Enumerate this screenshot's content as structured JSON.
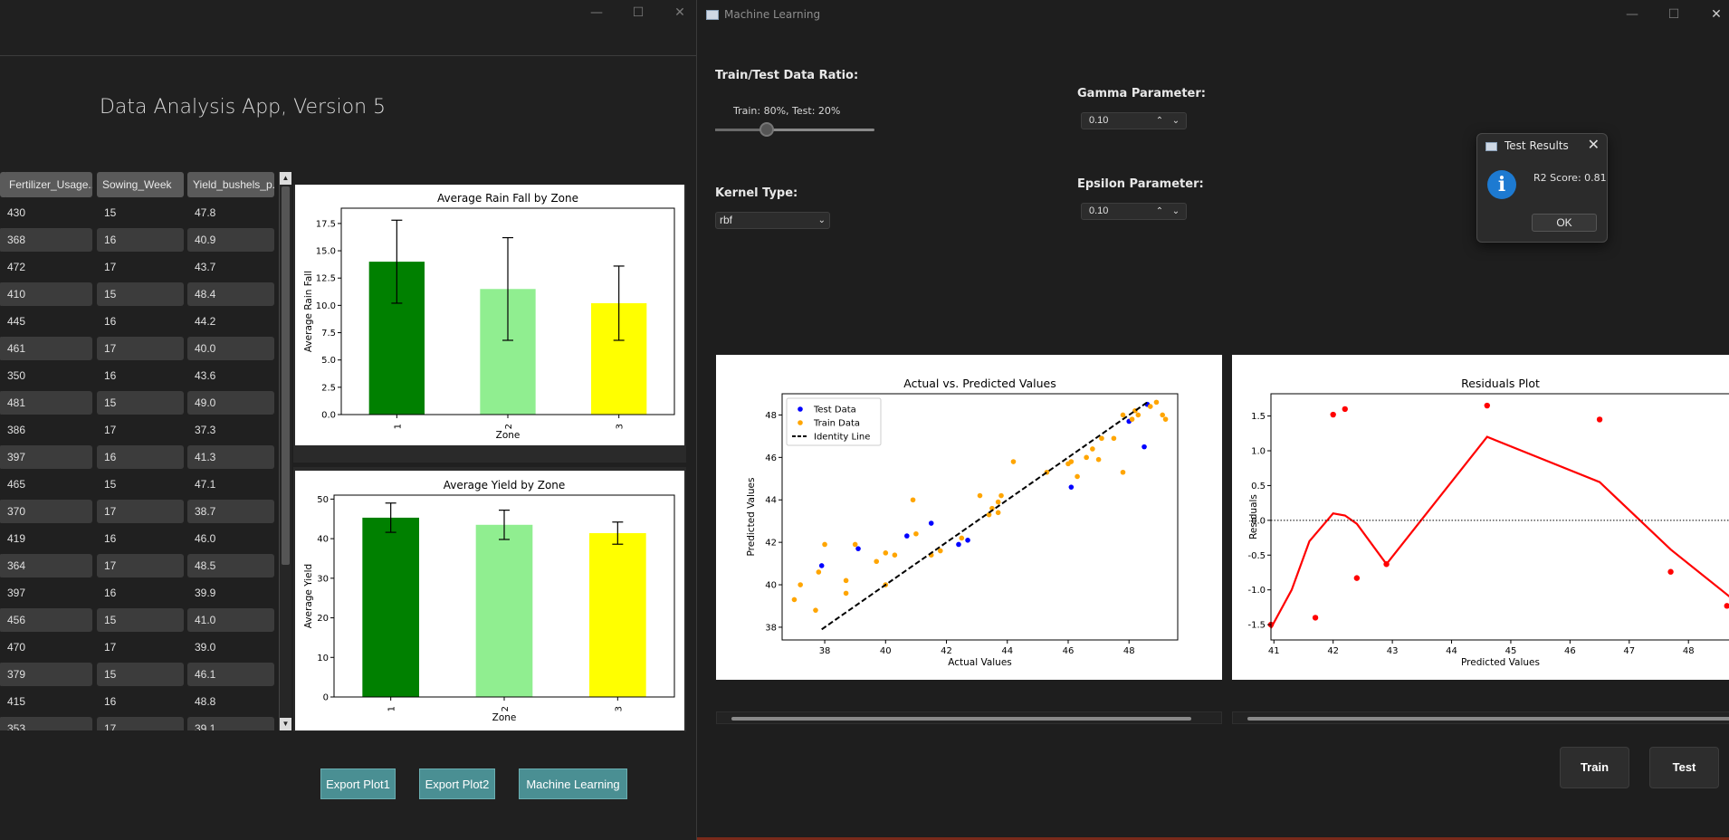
{
  "main_window": {
    "app_title": "Data Analysis App, Version 5",
    "controls": {
      "minimize": "—",
      "maximize": "☐",
      "close": "✕"
    },
    "table": {
      "columns": [
        "Fertilizer_Usage...",
        "Sowing_Week",
        "Yield_bushels_p..."
      ],
      "rows": [
        [
          "430",
          "15",
          "47.8"
        ],
        [
          "368",
          "16",
          "40.9"
        ],
        [
          "472",
          "17",
          "43.7"
        ],
        [
          "410",
          "15",
          "48.4"
        ],
        [
          "445",
          "16",
          "44.2"
        ],
        [
          "461",
          "17",
          "40.0"
        ],
        [
          "350",
          "16",
          "43.6"
        ],
        [
          "481",
          "15",
          "49.0"
        ],
        [
          "386",
          "17",
          "37.3"
        ],
        [
          "397",
          "16",
          "41.3"
        ],
        [
          "465",
          "15",
          "47.1"
        ],
        [
          "370",
          "17",
          "38.7"
        ],
        [
          "419",
          "16",
          "46.0"
        ],
        [
          "364",
          "17",
          "48.5"
        ],
        [
          "397",
          "16",
          "39.9"
        ],
        [
          "456",
          "15",
          "41.0"
        ],
        [
          "470",
          "17",
          "39.0"
        ],
        [
          "379",
          "15",
          "46.1"
        ],
        [
          "415",
          "16",
          "48.8"
        ],
        [
          "353",
          "17",
          "39.1"
        ]
      ],
      "scroll_up": "▲",
      "scroll_down": "▼"
    },
    "buttons": {
      "export1": "Export Plot1",
      "export2": "Export Plot2",
      "ml": "Machine Learning"
    }
  },
  "ml_window": {
    "title": "Machine Learning",
    "controls": {
      "minimize": "—",
      "maximize": "☐",
      "close": "✕"
    },
    "train_test_label": "Train/Test Data Ratio:",
    "train_test_value": "Train: 80%, Test: 20%",
    "train_ratio": 0.8,
    "kernel_label": "Kernel Type:",
    "kernel_value": "rbf",
    "gamma_label": "Gamma Parameter:",
    "gamma_value": "0.10",
    "epsilon_label": "Epsilon Parameter:",
    "epsilon_value": "0.10",
    "train_button": "Train",
    "test_button": "Test"
  },
  "dialog": {
    "title": "Test Results",
    "message": "R2 Score: 0.81",
    "ok": "OK",
    "close": "✕",
    "info_glyph": "i"
  },
  "chart_data": [
    {
      "type": "bar",
      "title": "Average Rain Fall by Zone",
      "xlabel": "Zone",
      "ylabel": "Average Rain Fall",
      "categories": [
        "1",
        "2",
        "3"
      ],
      "values": [
        14.0,
        11.5,
        10.2
      ],
      "error": [
        3.8,
        4.7,
        3.4
      ],
      "colors": [
        "#008000",
        "#90ee90",
        "#ffff00"
      ],
      "ylim": [
        0,
        18.9
      ],
      "yticks": [
        "0.0",
        "2.5",
        "5.0",
        "7.5",
        "10.0",
        "12.5",
        "15.0",
        "17.5"
      ]
    },
    {
      "type": "bar",
      "title": "Average Yield by Zone",
      "xlabel": "Zone",
      "ylabel": "Average Yield",
      "categories": [
        "1",
        "2",
        "3"
      ],
      "values": [
        45.3,
        43.5,
        41.4
      ],
      "error": [
        3.7,
        3.7,
        2.8
      ],
      "colors": [
        "#008000",
        "#90ee90",
        "#ffff00"
      ],
      "ylim": [
        0,
        51
      ],
      "yticks": [
        "0",
        "10",
        "20",
        "30",
        "40",
        "50"
      ]
    },
    {
      "type": "scatter",
      "title": "Actual vs. Predicted Values",
      "xlabel": "Actual Values",
      "ylabel": "Predicted Values",
      "xlim": [
        36.6,
        49.6
      ],
      "ylim": [
        37.4,
        49.0
      ],
      "xticks": [
        38,
        40,
        42,
        44,
        46,
        48
      ],
      "yticks": [
        38,
        40,
        42,
        44,
        46,
        48
      ],
      "legend": [
        "Test Data",
        "Train Data",
        "Identity Line"
      ],
      "series": [
        {
          "name": "Test Data",
          "color": "#0000ff",
          "points": [
            [
              37.9,
              40.9
            ],
            [
              39.1,
              41.7
            ],
            [
              40.7,
              42.3
            ],
            [
              41.5,
              42.9
            ],
            [
              42.4,
              41.9
            ],
            [
              42.7,
              42.1
            ],
            [
              46.1,
              44.6
            ],
            [
              48.0,
              47.7
            ],
            [
              48.5,
              46.5
            ],
            [
              48.6,
              48.5
            ]
          ]
        },
        {
          "name": "Train Data",
          "color": "#ffa500",
          "points": [
            [
              37.0,
              39.3
            ],
            [
              37.2,
              40.0
            ],
            [
              37.7,
              38.8
            ],
            [
              37.8,
              40.6
            ],
            [
              38.0,
              41.9
            ],
            [
              38.7,
              40.2
            ],
            [
              38.7,
              39.6
            ],
            [
              39.0,
              41.9
            ],
            [
              39.7,
              41.1
            ],
            [
              40.0,
              41.5
            ],
            [
              40.0,
              40.0
            ],
            [
              40.3,
              41.4
            ],
            [
              40.9,
              44.0
            ],
            [
              41.0,
              42.4
            ],
            [
              41.5,
              41.4
            ],
            [
              41.8,
              41.6
            ],
            [
              42.5,
              42.2
            ],
            [
              43.1,
              44.2
            ],
            [
              43.4,
              43.3
            ],
            [
              43.5,
              43.6
            ],
            [
              43.7,
              43.4
            ],
            [
              43.7,
              43.9
            ],
            [
              43.8,
              44.2
            ],
            [
              44.2,
              45.8
            ],
            [
              45.3,
              45.3
            ],
            [
              46.0,
              45.7
            ],
            [
              46.1,
              45.8
            ],
            [
              46.3,
              45.1
            ],
            [
              46.6,
              46.0
            ],
            [
              46.8,
              46.4
            ],
            [
              47.0,
              45.9
            ],
            [
              47.1,
              46.9
            ],
            [
              47.5,
              46.9
            ],
            [
              47.8,
              45.3
            ],
            [
              47.8,
              48.0
            ],
            [
              48.1,
              47.8
            ],
            [
              48.2,
              48.2
            ],
            [
              48.3,
              48.0
            ],
            [
              48.7,
              48.4
            ],
            [
              48.9,
              48.6
            ],
            [
              49.1,
              48.0
            ],
            [
              49.2,
              47.8
            ]
          ]
        },
        {
          "name": "Identity Line",
          "color": "#000000",
          "line": [
            [
              37.9,
              37.9
            ],
            [
              48.6,
              48.6
            ]
          ]
        }
      ]
    },
    {
      "type": "scatter",
      "title": "Residuals Plot",
      "xlabel": "Predicted Values",
      "ylabel": "Residuals",
      "xlim": [
        40.95,
        48.7
      ],
      "ylim": [
        -1.72,
        1.82
      ],
      "xticks": [
        41,
        42,
        43,
        44,
        45,
        46,
        47,
        48
      ],
      "yticks": [
        -1.5,
        -1.0,
        -0.5,
        0.0,
        0.5,
        1.0,
        1.5
      ],
      "series": [
        {
          "name": "points",
          "color": "#ff0000",
          "points": [
            [
              40.95,
              -1.5
            ],
            [
              41.7,
              -1.4
            ],
            [
              42.0,
              1.52
            ],
            [
              42.2,
              1.6
            ],
            [
              42.4,
              -0.83
            ],
            [
              42.9,
              -0.63
            ],
            [
              44.6,
              1.65
            ],
            [
              46.5,
              1.45
            ],
            [
              47.7,
              -0.74
            ],
            [
              48.65,
              -1.23
            ]
          ]
        },
        {
          "name": "fit",
          "color": "#ff0000",
          "line": [
            [
              40.95,
              -1.55
            ],
            [
              41.3,
              -1.0
            ],
            [
              41.6,
              -0.3
            ],
            [
              42.0,
              0.1
            ],
            [
              42.2,
              0.07
            ],
            [
              42.4,
              -0.05
            ],
            [
              42.9,
              -0.63
            ],
            [
              44.6,
              1.2
            ],
            [
              46.5,
              0.55
            ],
            [
              47.7,
              -0.42
            ],
            [
              48.7,
              -1.1
            ]
          ]
        },
        {
          "name": "zero",
          "color": "#000000",
          "hline": 0.0
        }
      ]
    }
  ]
}
